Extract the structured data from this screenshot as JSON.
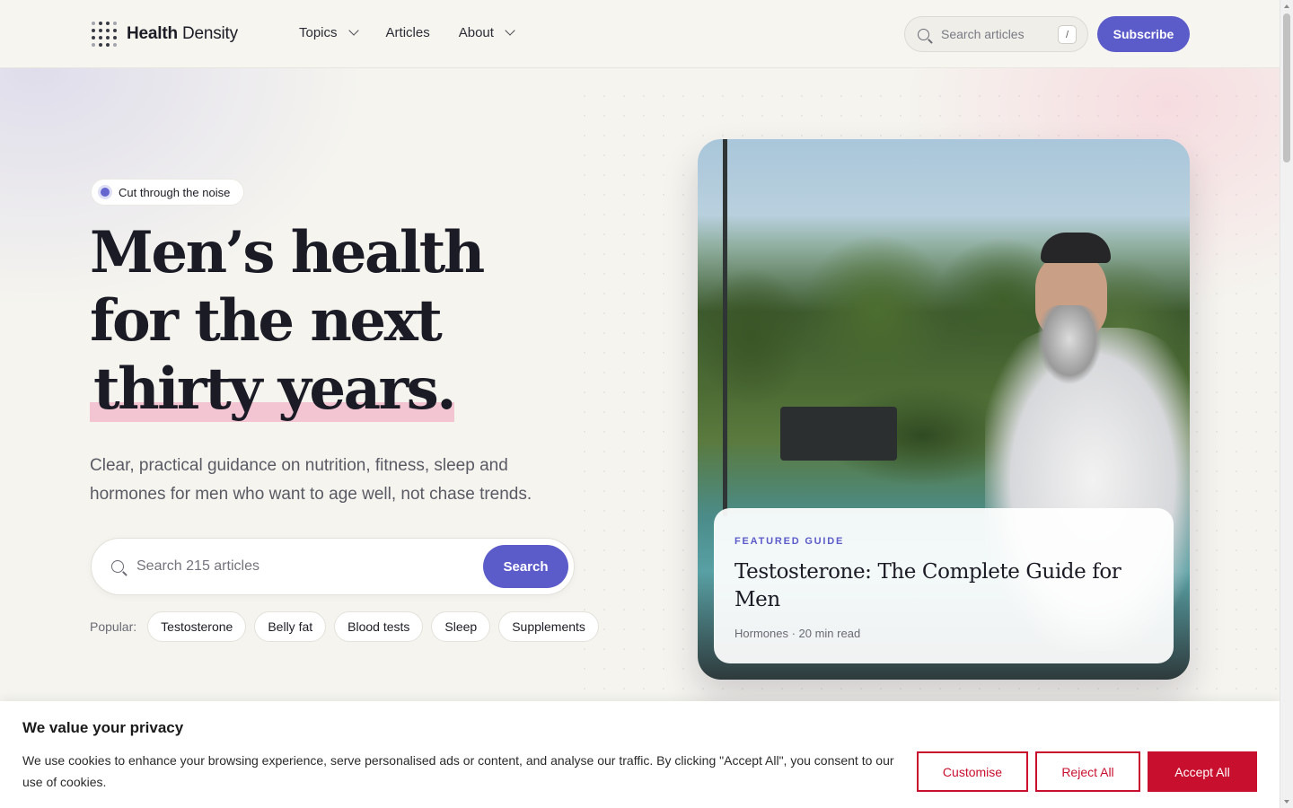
{
  "header": {
    "brand_bold": "Health",
    "brand_rest": " Density",
    "nav": [
      {
        "label": "Topics",
        "has_dropdown": true
      },
      {
        "label": "Articles",
        "has_dropdown": false
      },
      {
        "label": "About",
        "has_dropdown": true
      }
    ],
    "search_placeholder": "Search articles",
    "search_shortcut": "/",
    "subscribe_label": "Subscribe"
  },
  "hero": {
    "badge": "Cut through the noise",
    "headline_line1": "Men’s health",
    "headline_line2": "for the next",
    "headline_line3": "thirty years.",
    "subtitle": "Clear, practical guidance on nutrition, fitness, sleep and hormones for men who want to age well, not chase trends.",
    "search_placeholder": "Search 215 articles",
    "search_button": "Search",
    "popular_label": "Popular:",
    "popular_tags": [
      "Testosterone",
      "Belly fat",
      "Blood tests",
      "Sleep",
      "Supplements"
    ]
  },
  "featured": {
    "kicker": "FEATURED GUIDE",
    "title": "Testosterone: The Complete Guide for Men",
    "meta": "Hormones · 20 min read"
  },
  "cookie": {
    "title": "We value your privacy",
    "text": "We use cookies to enhance your browsing experience, serve personalised ads or content, and analyse our traffic. By clicking \"Accept All\", you consent to our use of cookies.",
    "customise": "Customise",
    "reject": "Reject All",
    "accept": "Accept All"
  },
  "colors": {
    "accent": "#5b5bc9",
    "highlight": "#f3c5d3",
    "cookie_red": "#c8102e"
  }
}
